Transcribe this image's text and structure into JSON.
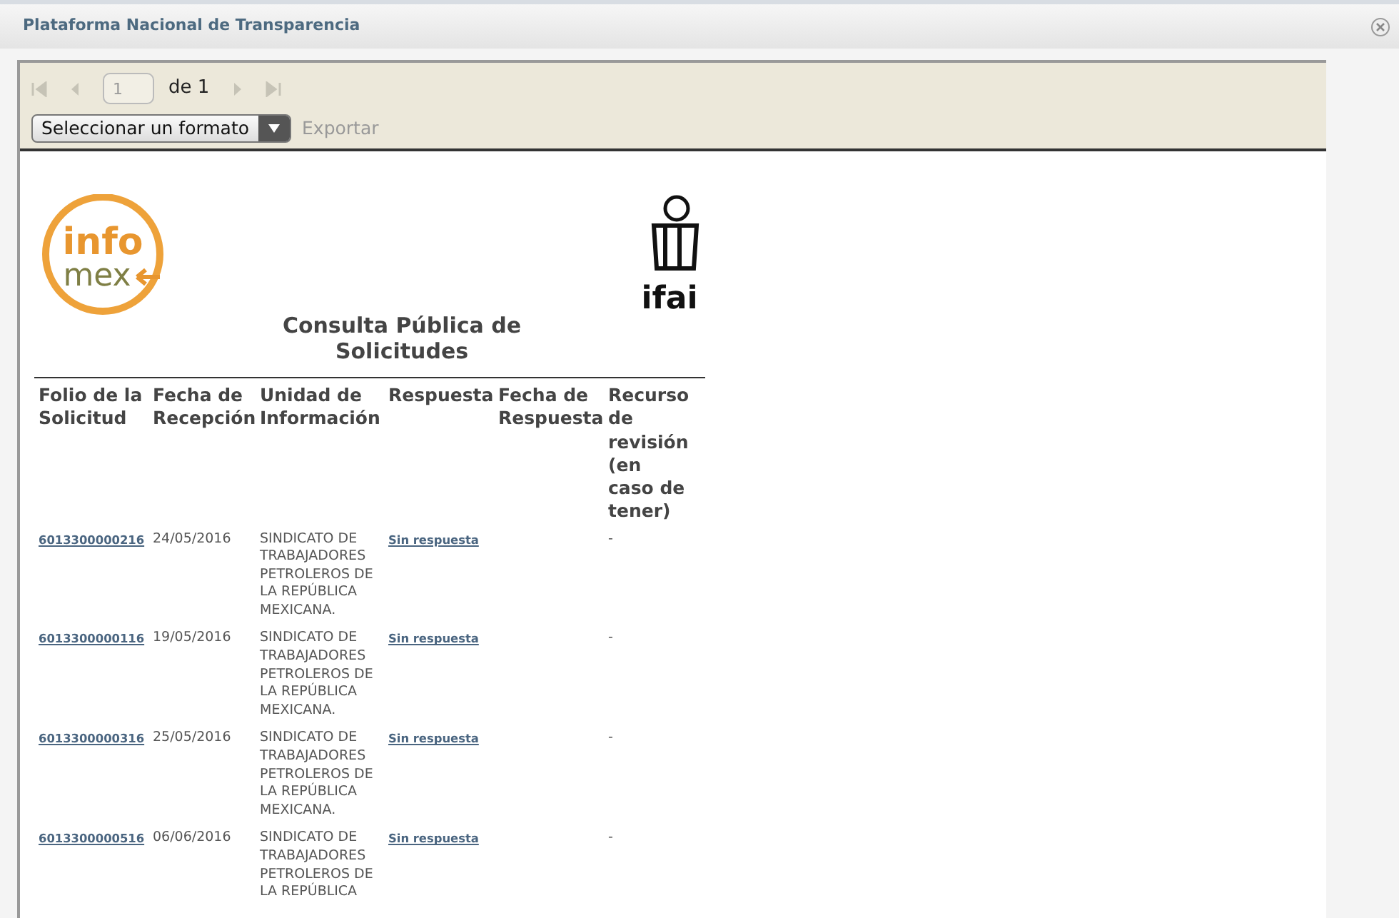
{
  "window": {
    "title": "Plataforma Nacional de Transparencia"
  },
  "toolbar": {
    "page": "1",
    "page_count": "de 1",
    "format_select": "Seleccionar un formato",
    "export": "Exportar"
  },
  "logos": {
    "infomex": [
      "info",
      "mex"
    ],
    "ifai": "ifai"
  },
  "report": {
    "title": "Consulta Pública de Solicitudes",
    "columns": [
      "Folio de la Solicitud",
      "Fecha de Recepción",
      "Unidad de Información",
      "Respuesta",
      "Fecha de Respuesta",
      "Recurso de revisión (en caso de tener)"
    ],
    "rows": [
      {
        "folio": "6013300000216",
        "fecha": "24/05/2016",
        "unidad": "SINDICATO DE TRABAJADORES PETROLEROS DE LA REPÚBLICA MEXICANA.",
        "respuesta": "Sin respuesta",
        "recurso": "-"
      },
      {
        "folio": "6013300000116",
        "fecha": "19/05/2016",
        "unidad": "SINDICATO DE TRABAJADORES PETROLEROS DE LA REPÚBLICA MEXICANA.",
        "respuesta": "Sin respuesta",
        "recurso": "-"
      },
      {
        "folio": "6013300000316",
        "fecha": "25/05/2016",
        "unidad": "SINDICATO DE TRABAJADORES PETROLEROS DE LA REPÚBLICA MEXICANA.",
        "respuesta": "Sin respuesta",
        "recurso": "-"
      },
      {
        "folio": "6013300000516",
        "fecha": "06/06/2016",
        "unidad": "SINDICATO DE TRABAJADORES PETROLEROS DE LA REPÚBLICA",
        "respuesta": "Sin respuesta",
        "recurso": "-"
      }
    ]
  }
}
